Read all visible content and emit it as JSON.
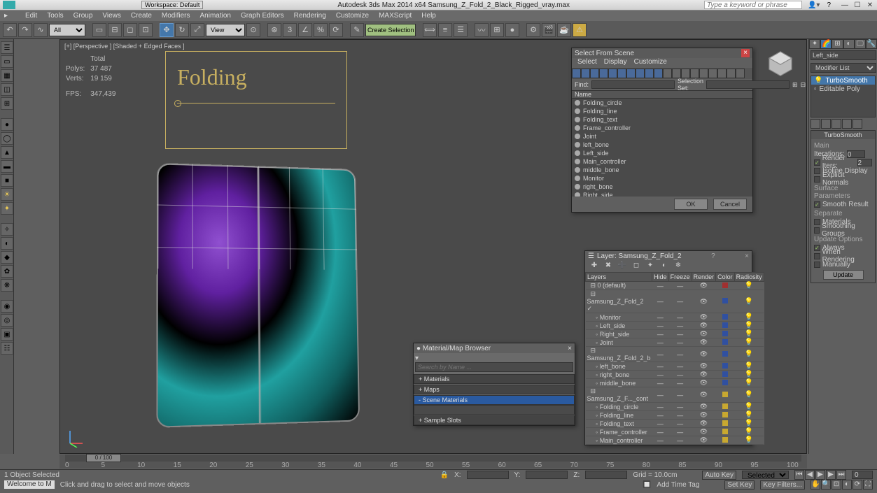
{
  "app": {
    "title_center": "Autodesk 3ds Max  2014 x64     Samsung_Z_Fold_2_Black_Rigged_vray.max",
    "workspace": "Workspace: Default",
    "search_placeholder": "Type a keyword or phrase"
  },
  "menu": [
    "Edit",
    "Tools",
    "Group",
    "Views",
    "Create",
    "Modifiers",
    "Animation",
    "Graph Editors",
    "Rendering",
    "Customize",
    "MAXScript",
    "Help"
  ],
  "toolbar": {
    "combo_sel": "All",
    "combo_view": "View",
    "named_sel": "Create Selection S"
  },
  "viewport": {
    "label": "[+] [Perspective ] [Shaded + Edged Faces ]",
    "stats": {
      "total": "Total",
      "polys_l": "Polys:",
      "polys": "37 487",
      "verts_l": "Verts:",
      "verts": "19 159",
      "fps_l": "FPS:",
      "fps": "347,439"
    },
    "fold_text": "Folding"
  },
  "sel_scene": {
    "title": "Select From Scene",
    "tabs": [
      "Select",
      "Display",
      "Customize"
    ],
    "find": "Find:",
    "selset": "Selection Set:",
    "name_hdr": "Name",
    "items": [
      "Folding_circle",
      "Folding_line",
      "Folding_text",
      "Frame_controller",
      "Joint",
      "left_bone",
      "Left_side",
      "Main_controller",
      "middle_bone",
      "Monitor",
      "right_bone",
      "Right_side"
    ],
    "ok": "OK",
    "cancel": "Cancel"
  },
  "layer": {
    "title": "Layer: Samsung_Z_Fold_2",
    "cols": [
      "Layers",
      "Hide",
      "Freeze",
      "Render",
      "Color",
      "Radiosity"
    ],
    "rows": [
      {
        "name": "0 (default)",
        "d": 0,
        "c": "#a03030"
      },
      {
        "name": "Samsung_Z_Fold_2",
        "d": 0,
        "c": "#3050a0",
        "chk": true
      },
      {
        "name": "Monitor",
        "d": 1,
        "c": "#3050a0"
      },
      {
        "name": "Left_side",
        "d": 1,
        "c": "#3050a0"
      },
      {
        "name": "Right_side",
        "d": 1,
        "c": "#3050a0"
      },
      {
        "name": "Joint",
        "d": 1,
        "c": "#3050a0"
      },
      {
        "name": "Samsung_Z_Fold_2_b",
        "d": 0,
        "c": "#3050a0"
      },
      {
        "name": "left_bone",
        "d": 1,
        "c": "#3050a0"
      },
      {
        "name": "right_bone",
        "d": 1,
        "c": "#3050a0"
      },
      {
        "name": "middle_bone",
        "d": 1,
        "c": "#3050a0"
      },
      {
        "name": "Samsung_Z_F..._cont",
        "d": 0,
        "c": "#c8a830"
      },
      {
        "name": "Folding_circle",
        "d": 1,
        "c": "#c8a830"
      },
      {
        "name": "Folding_line",
        "d": 1,
        "c": "#c8a830"
      },
      {
        "name": "Folding_text",
        "d": 1,
        "c": "#c8a830"
      },
      {
        "name": "Frame_controller",
        "d": 1,
        "c": "#c8a830"
      },
      {
        "name": "Main_controller",
        "d": 1,
        "c": "#c8a830"
      }
    ]
  },
  "mat": {
    "title": "Material/Map Browser",
    "search": "Search by Name ...",
    "cats": [
      "+ Materials",
      "+ Maps",
      "- Scene Materials",
      "+ Sample Slots"
    ]
  },
  "rpanel": {
    "obj": "Left_side",
    "modlist": "Modifier List",
    "stack": [
      {
        "n": "TurboSmooth",
        "sel": true
      },
      {
        "n": "Editable Poly"
      }
    ],
    "roll_title": "TurboSmooth",
    "main": "Main",
    "iter": "Iterations:",
    "iter_v": "0",
    "rend": "Render Iters:",
    "rend_v": "2",
    "iso": "Isoline Display",
    "exp": "Explicit Normals",
    "surf": "Surface Parameters",
    "smooth": "Smooth Result",
    "sep": "Separate",
    "mats": "Materials",
    "sg": "Smoothing Groups",
    "upd": "Update Options",
    "always": "Always",
    "whenr": "When Rendering",
    "man": "Manually",
    "upd_btn": "Update"
  },
  "timeline": {
    "knob": "0 / 100",
    "ticks": [
      "0",
      "5",
      "10",
      "15",
      "20",
      "25",
      "30",
      "35",
      "40",
      "45",
      "50",
      "55",
      "60",
      "65",
      "70",
      "75",
      "80",
      "85",
      "90",
      "95",
      "100"
    ]
  },
  "status": {
    "sel": "1 Object Selected",
    "hint": "Click and drag to select and move objects",
    "welcome": "Welcome to M",
    "x": "X:",
    "y": "Y:",
    "z": "Z:",
    "grid": "Grid = 10.0cm",
    "auto": "Auto Key",
    "setkey": "Set Key",
    "keyf": "Key Filters...",
    "selected": "Selected",
    "addtag": "Add Time Tag"
  }
}
